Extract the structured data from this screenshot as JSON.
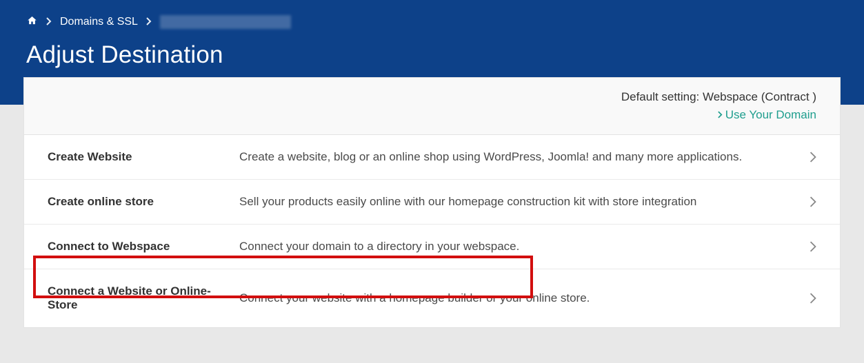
{
  "breadcrumb": {
    "domains_ssl": "Domains & SSL"
  },
  "page_title": "Adjust Destination",
  "panel_header": {
    "default_setting": "Default setting: Webspace (Contract )",
    "use_domain": "Use Your Domain"
  },
  "options": {
    "create_website": {
      "title": "Create Website",
      "desc": "Create a website, blog or an online shop using WordPress, Joomla! and many more applications."
    },
    "create_store": {
      "title": "Create online store",
      "desc": "Sell your products easily online with our homepage construction kit with store integration"
    },
    "connect_webspace": {
      "title": "Connect to Webspace",
      "desc": "Connect your domain to a directory in your webspace."
    },
    "connect_website": {
      "title": "Connect a Website or Online-Store",
      "desc": "Connect your website with a homepage builder or your online store."
    }
  }
}
